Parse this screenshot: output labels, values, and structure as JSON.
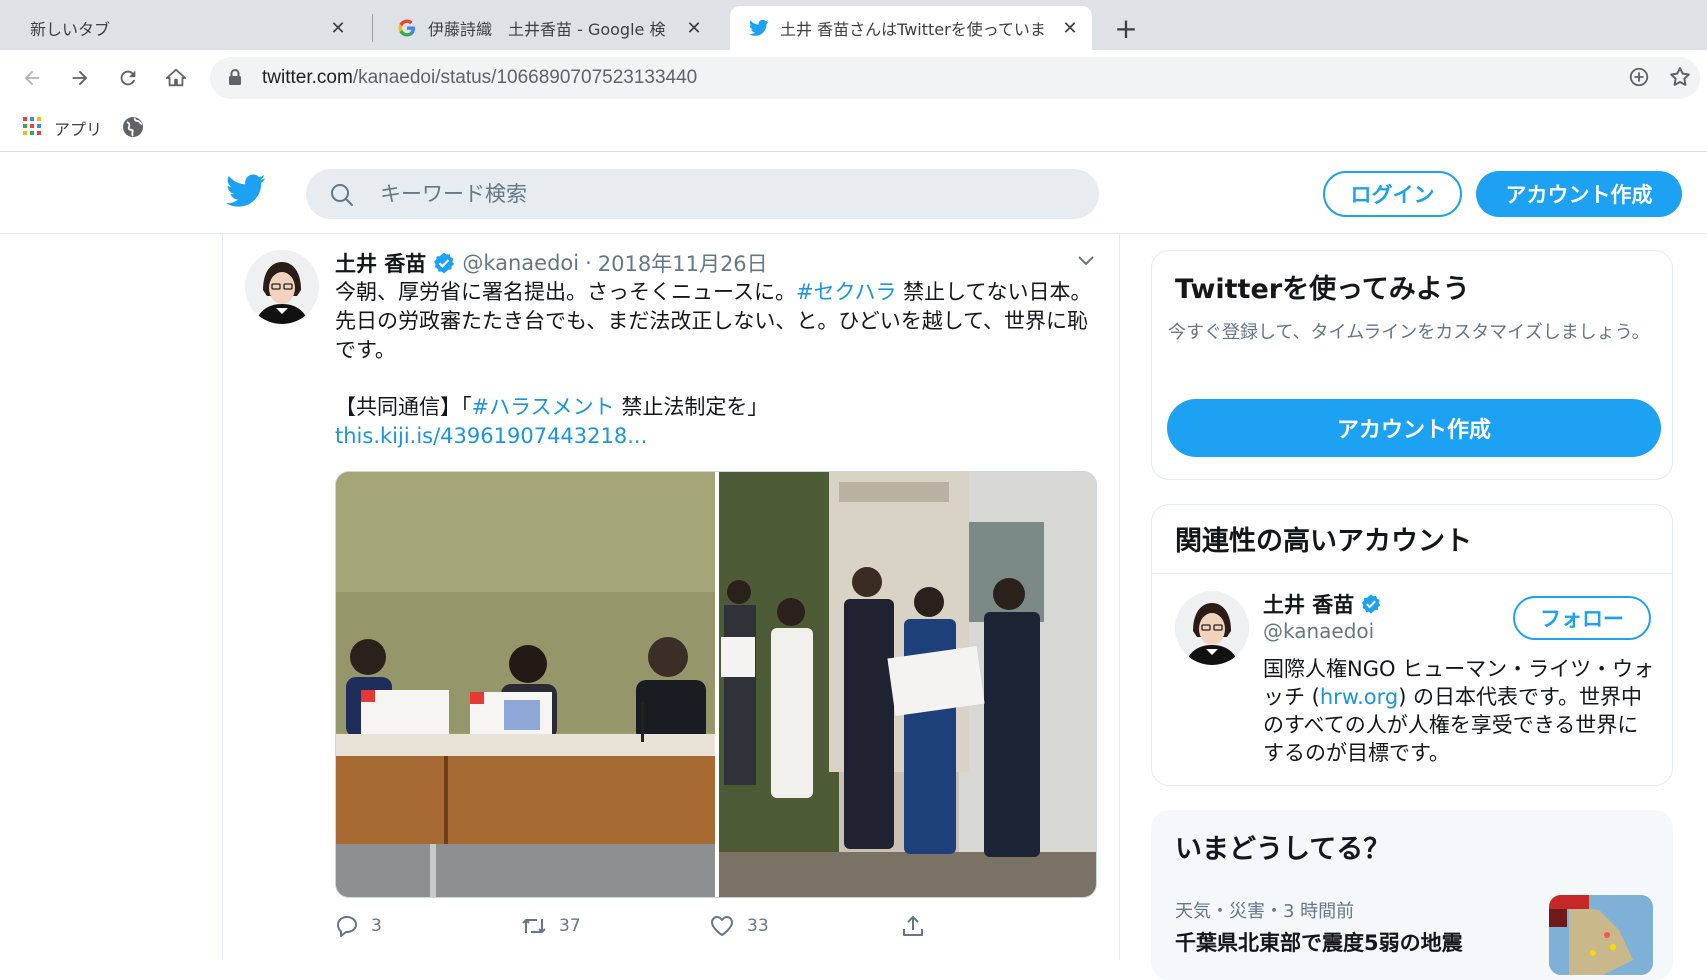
{
  "browser": {
    "tabs": [
      {
        "label": "新しいタブ",
        "active": false
      },
      {
        "label": "伊藤詩織　土井香苗 - Google 検",
        "active": false
      },
      {
        "label": "土井 香苗さんはTwitterを使っていま",
        "active": true
      }
    ],
    "url_host": "twitter.com",
    "url_path": "/kanaedoi/status/1066890707523133440",
    "bookmarks": {
      "apps_label": "アプリ"
    }
  },
  "header": {
    "search_placeholder": "キーワード検索",
    "login_label": "ログイン",
    "signup_label": "アカウント作成"
  },
  "tweet": {
    "name": "土井 香苗",
    "handle": "@kanaedoi",
    "separator": "·",
    "date": "2018年11月26日",
    "text_part1": "今朝、厚労省に署名提出。さっそくニュースに。",
    "hashtag1": "#セクハラ",
    "text_part2": " 禁止してない日本。先日の労政審たたき台でも、まだ法改正しない、と。ひどいを越して、世界に恥です。",
    "text_part3": "【共同通信】「",
    "hashtag2": "#ハラスメント",
    "text_part4": " 禁止法制定を」",
    "link": "this.kiji.is/43961907443218...",
    "replies": "3",
    "retweets": "37",
    "likes": "33"
  },
  "sidebar": {
    "try_card": {
      "title": "Twitterを使ってみよう",
      "subtitle": "今すぐ登録して、タイムラインをカスタマイズしましょう。",
      "button": "アカウント作成"
    },
    "related": {
      "title": "関連性の高いアカウント",
      "name": "土井 香苗",
      "handle": "@kanaedoi",
      "follow_label": "フォロー",
      "bio_part1": "国際人権NGO ヒューマン・ライツ・ウォッチ (",
      "bio_link": "hrw.org",
      "bio_part2": ") の日本代表です。世界中のすべての人が人権を享受できる世界にするのが目標です。"
    },
    "trends": {
      "title": "いまどうしてる？",
      "meta": "天気・災害・3 時間前",
      "headline": "千葉県北東部で震度5弱の地震"
    }
  },
  "colors": {
    "twitter_blue": "#1da1f2",
    "link_blue": "#1b95e0",
    "secondary_text": "#657786"
  }
}
